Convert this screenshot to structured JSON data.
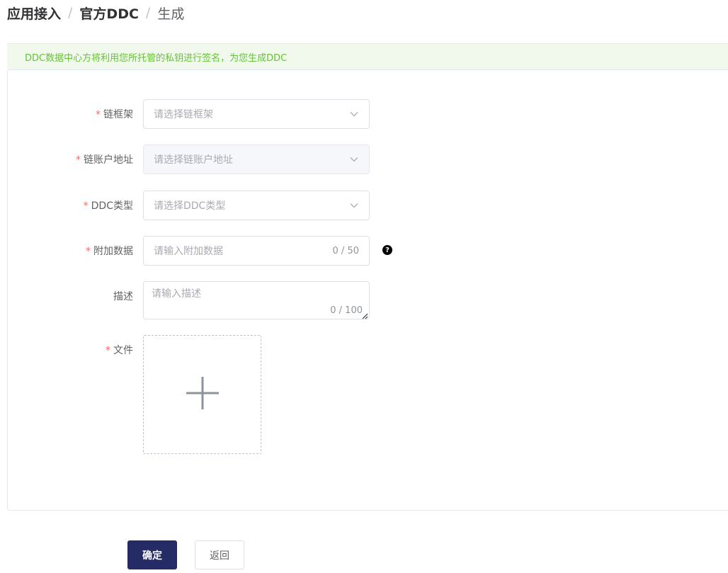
{
  "breadcrumb": {
    "items": [
      "应用接入",
      "官方DDC",
      "生成"
    ],
    "separator": "/"
  },
  "alert": {
    "text": "DDC数据中心方将利用您所托管的私钥进行签名，为您生成DDC"
  },
  "form": {
    "required_mark": "*",
    "chain_framework": {
      "label": "链框架",
      "placeholder": "请选择链框架"
    },
    "chain_account": {
      "label": "链账户地址",
      "placeholder": "请选择链账户地址",
      "disabled": true
    },
    "ddc_type": {
      "label": "DDC类型",
      "placeholder": "请选择DDC类型"
    },
    "extra_data": {
      "label": "附加数据",
      "placeholder": "请输入附加数据",
      "counter": "0 / 50",
      "help_icon": "question-circle-icon"
    },
    "description": {
      "label": "描述",
      "placeholder": "请输入描述",
      "counter": "0 / 100"
    },
    "file": {
      "label": "文件",
      "upload_icon": "plus-icon"
    }
  },
  "actions": {
    "confirm_label": "确定",
    "back_label": "返回"
  },
  "colors": {
    "primary": "#252b64",
    "success_text": "#67c23a",
    "success_bg": "#f0f9eb",
    "required": "#f56c6c"
  }
}
